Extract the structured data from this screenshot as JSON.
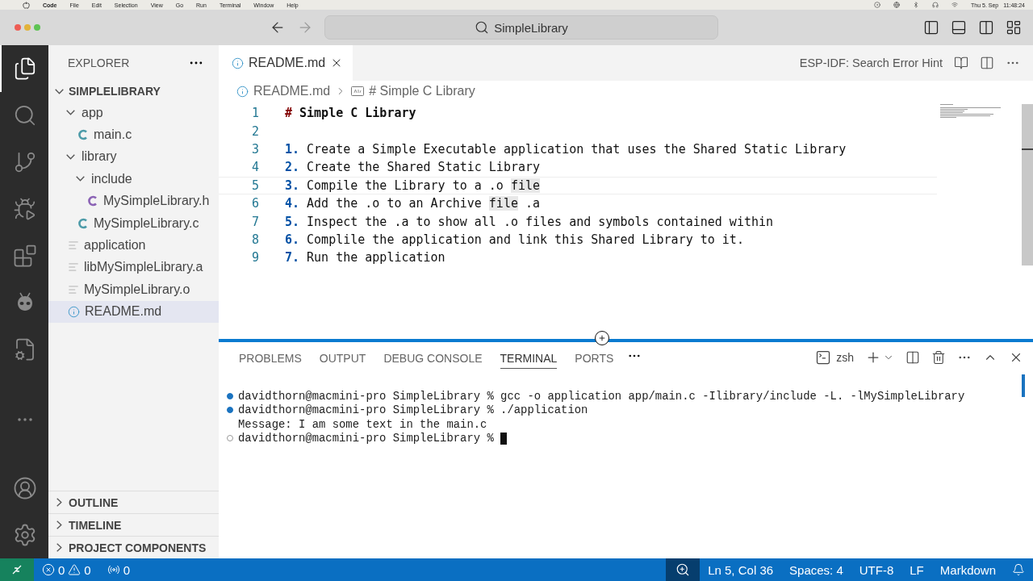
{
  "menu_bar": {
    "app": "Code",
    "menus": [
      "File",
      "Edit",
      "Selection",
      "View",
      "Go",
      "Run",
      "Terminal",
      "Window",
      "Help"
    ],
    "date": "Thu 5. Sep",
    "time": "11:48:24"
  },
  "title_bar": {
    "search": "SimpleLibrary"
  },
  "activity_bar": {
    "items": [
      {
        "kind": "explorer",
        "selected": true
      },
      {
        "kind": "search",
        "selected": false
      },
      {
        "kind": "source-control",
        "selected": false
      },
      {
        "kind": "run",
        "selected": false
      },
      {
        "kind": "extensions",
        "selected": false
      },
      {
        "kind": "alien",
        "selected": false
      },
      {
        "kind": "esp",
        "selected": false
      }
    ]
  },
  "sidebar": {
    "title": "EXPLORER",
    "root": {
      "label": "SIMPLELIBRARY",
      "expanded": true
    },
    "tree": [
      {
        "label": "app",
        "kind": "folder",
        "expanded": true,
        "selected": false,
        "children": [
          {
            "label": "main.c",
            "kind": "c",
            "selected": false
          }
        ]
      },
      {
        "label": "library",
        "kind": "folder",
        "expanded": true,
        "selected": false,
        "children": [
          {
            "label": "include",
            "kind": "folder",
            "expanded": true,
            "selected": false,
            "children": [
              {
                "label": "MySimpleLibrary.h",
                "kind": "h",
                "selected": false
              }
            ]
          },
          {
            "label": "MySimpleLibrary.c",
            "kind": "c",
            "selected": false
          }
        ]
      },
      {
        "label": "application",
        "kind": "text",
        "selected": false
      },
      {
        "label": "libMySimpleLibrary.a",
        "kind": "text",
        "selected": false
      },
      {
        "label": "MySimpleLibrary.o",
        "kind": "text",
        "selected": false
      },
      {
        "label": "README.md",
        "kind": "info",
        "selected": true
      }
    ],
    "sections": [
      {
        "label": "OUTLINE",
        "expanded": false
      },
      {
        "label": "TIMELINE",
        "expanded": false
      },
      {
        "label": "PROJECT COMPONENTS",
        "expanded": false
      }
    ]
  },
  "editor": {
    "tabs": [
      {
        "label": "README.md",
        "selected": true
      }
    ],
    "action": "ESP-IDF: Search Error Hint",
    "breadcrumb": [
      "README.md",
      "# Simple C Library"
    ],
    "lines": [
      {
        "number": "1",
        "kind": "heading",
        "marker": "#",
        "parts": [
          {
            "text": "Simple C Library",
            "highlighted": false
          }
        ]
      },
      {
        "number": "2",
        "kind": "empty"
      },
      {
        "number": "3",
        "kind": "item",
        "marker": "1.",
        "parts": [
          {
            "text": "Create a Simple Executable application that uses the Shared Static Library",
            "highlighted": false
          }
        ]
      },
      {
        "number": "4",
        "kind": "item",
        "marker": "2.",
        "parts": [
          {
            "text": "Create the Shared Static Library",
            "highlighted": false
          }
        ]
      },
      {
        "number": "5",
        "kind": "item",
        "current": true,
        "marker": "3.",
        "parts": [
          {
            "text": "Compile the Library to a .o ",
            "highlighted": false
          },
          {
            "text": "file",
            "highlighted": true
          }
        ]
      },
      {
        "number": "6",
        "kind": "item",
        "marker": "4.",
        "parts": [
          {
            "text": "Add the .o to an Archive ",
            "highlighted": false
          },
          {
            "text": "file",
            "highlighted": true
          },
          {
            "text": " .a",
            "highlighted": false
          }
        ]
      },
      {
        "number": "7",
        "kind": "item",
        "marker": "5.",
        "parts": [
          {
            "text": "Inspect the .a to show all .o files and symbols contained within",
            "highlighted": false
          }
        ]
      },
      {
        "number": "8",
        "kind": "item",
        "marker": "6.",
        "parts": [
          {
            "text": "Complile the application and link this Shared Library to it.",
            "highlighted": false
          }
        ]
      },
      {
        "number": "9",
        "kind": "item",
        "marker": "7.",
        "parts": [
          {
            "text": "Run the application",
            "highlighted": false
          }
        ]
      }
    ]
  },
  "panel": {
    "tabs": [
      {
        "label": "PROBLEMS",
        "selected": false
      },
      {
        "label": "OUTPUT",
        "selected": false
      },
      {
        "label": "DEBUG CONSOLE",
        "selected": false
      },
      {
        "label": "TERMINAL",
        "selected": true
      },
      {
        "label": "PORTS",
        "selected": false
      }
    ],
    "shell": "zsh",
    "terminal": [
      {
        "kind": "command",
        "finished": true,
        "text": "davidthorn@macmini-pro SimpleLibrary % gcc -o application app/main.c -Ilibrary/include -L. -lMySimpleLibrary"
      },
      {
        "kind": "command",
        "finished": true,
        "text": "davidthorn@macmini-pro SimpleLibrary % ./application"
      },
      {
        "kind": "output",
        "text": "Message: I am some text in the main.c"
      },
      {
        "kind": "command",
        "finished": false,
        "cursor": true,
        "text": "davidthorn@macmini-pro SimpleLibrary % "
      }
    ]
  },
  "status_bar": {
    "errors": "0",
    "warnings": "0",
    "ports": "0",
    "position": "Ln 5, Col 36",
    "spaces": "Spaces: 4",
    "encoding": "UTF-8",
    "eol": "LF",
    "language": "Markdown"
  }
}
